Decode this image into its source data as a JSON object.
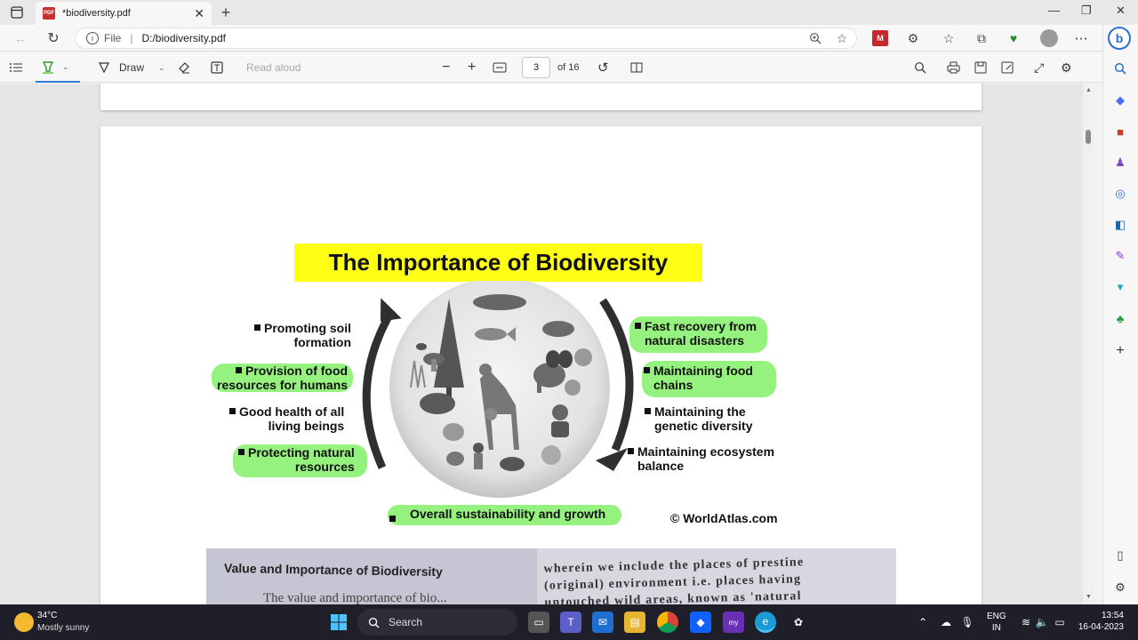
{
  "browser": {
    "tab_title": "*biodiversity.pdf",
    "tab_icon_text": "PDF",
    "new_tab": "+",
    "url_scheme": "File",
    "url_path": "D:/biodiversity.pdf"
  },
  "toolbar": {
    "draw_label": "Draw",
    "read_aloud_label": "Read aloud",
    "page_current": "3",
    "page_total": "of 16"
  },
  "infographic": {
    "title": "The Importance of Biodiversity",
    "left_labels": [
      "Promoting soil\nformation",
      "Provision of food\nresources for humans",
      "Good health of all\nliving beings",
      "Protecting natural\nresources"
    ],
    "right_labels": [
      "Fast recovery from\nnatural disasters",
      "Maintaining food\nchains",
      "Maintaining the\ngenetic diversity",
      "Maintaining ecosystem\nbalance"
    ],
    "bottom_label": "Overall sustainability and growth",
    "credit": "© WorldAtlas.com"
  },
  "photo": {
    "heading": "Value and Importance of Biodiversity",
    "left_text": "The value and importance of bio...",
    "right_lines": [
      "wherein we include the places of prestine",
      "(original) environment i.e. places having",
      "untouched wild areas, known as 'natural"
    ]
  },
  "taskbar": {
    "weather_temp": "34°C",
    "weather_desc": "Mostly sunny",
    "search_label": "Search",
    "lang_line1": "ENG",
    "lang_line2": "IN",
    "time": "13:54",
    "date": "16-04-2023"
  },
  "colors": {
    "highlight_yellow": "#ffff14",
    "highlight_green": "#96f27e",
    "taskbar_bg": "#1f1f2a"
  }
}
